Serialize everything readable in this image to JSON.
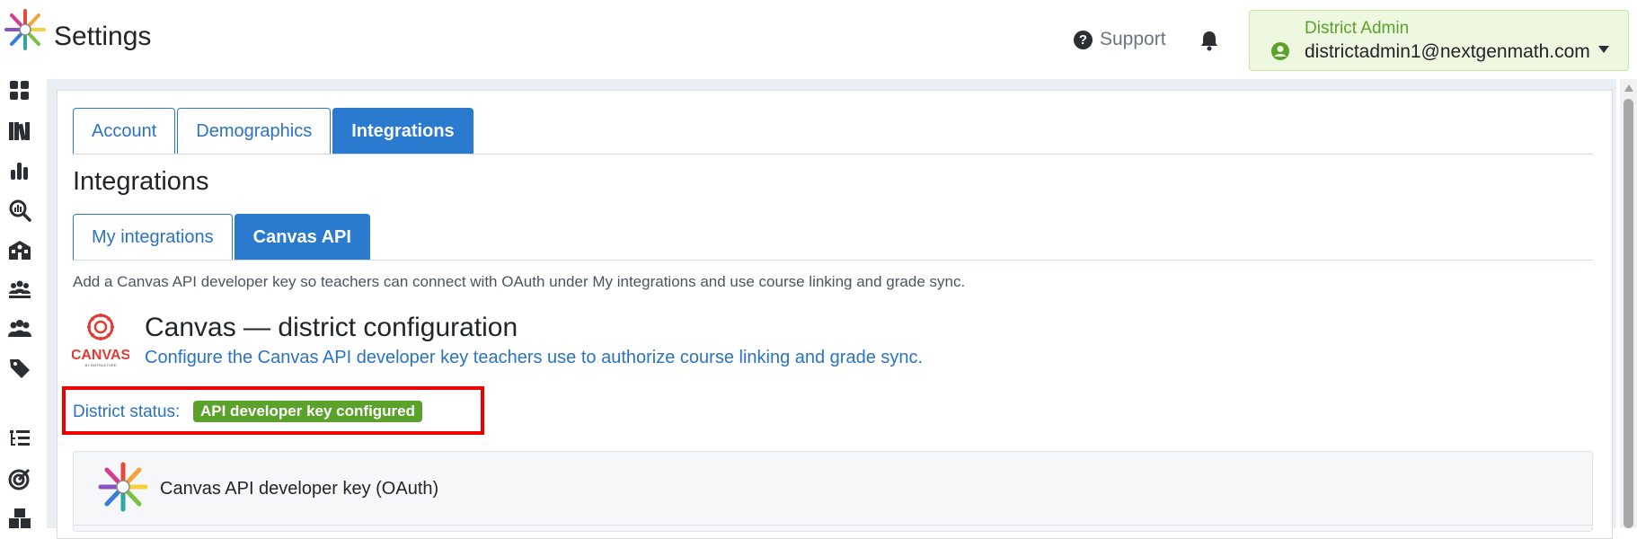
{
  "header": {
    "title": "Settings",
    "logo_icon": "starburst-logo-icon",
    "support_label": "Support",
    "support_icon": "question-circle-icon",
    "notification_icon": "bell-icon",
    "user": {
      "role": "District Admin",
      "email": "districtadmin1@nextgenmath.com",
      "avatar_icon": "user-circle-icon",
      "menu_icon": "caret-down-icon"
    }
  },
  "sidebar": {
    "items": [
      {
        "name": "dashboard",
        "icon": "grid-icon"
      },
      {
        "name": "library",
        "icon": "books-icon"
      },
      {
        "name": "reports",
        "icon": "bar-chart-icon"
      },
      {
        "name": "analytics",
        "icon": "search-chart-icon"
      },
      {
        "name": "schools",
        "icon": "school-icon"
      },
      {
        "name": "classes",
        "icon": "users-group-icon"
      },
      {
        "name": "users",
        "icon": "users-icon"
      },
      {
        "name": "tags",
        "icon": "tag-icon"
      },
      {
        "name": "lists",
        "icon": "list-tree-icon"
      },
      {
        "name": "goals",
        "icon": "target-icon"
      },
      {
        "name": "packages",
        "icon": "boxes-icon"
      }
    ]
  },
  "tabs": [
    "Account",
    "Demographics",
    "Integrations"
  ],
  "active_tab": "Integrations",
  "section_title": "Integrations",
  "subtabs": [
    "My integrations",
    "Canvas API"
  ],
  "active_subtab": "Canvas API",
  "help_text": "Add a Canvas API developer key so teachers can connect with OAuth under My integrations and use course linking and grade sync.",
  "canvas": {
    "logo_text": "CANVAS",
    "logo_subtext": "BY INSTRUCTURE",
    "title": "Canvas — district configuration",
    "subtitle": "Configure the Canvas API developer key teachers use to authorize course linking and grade sync.",
    "status_label": "District status:",
    "status_value": "API developer key configured",
    "status_color": "#5aa22b",
    "highlight_color": "#ee0000"
  },
  "card": {
    "title": "Canvas API developer key (OAuth)"
  },
  "colors": {
    "primary": "#2a7ad0",
    "success": "#5aa22b",
    "user_box_bg": "#eef8e0"
  }
}
